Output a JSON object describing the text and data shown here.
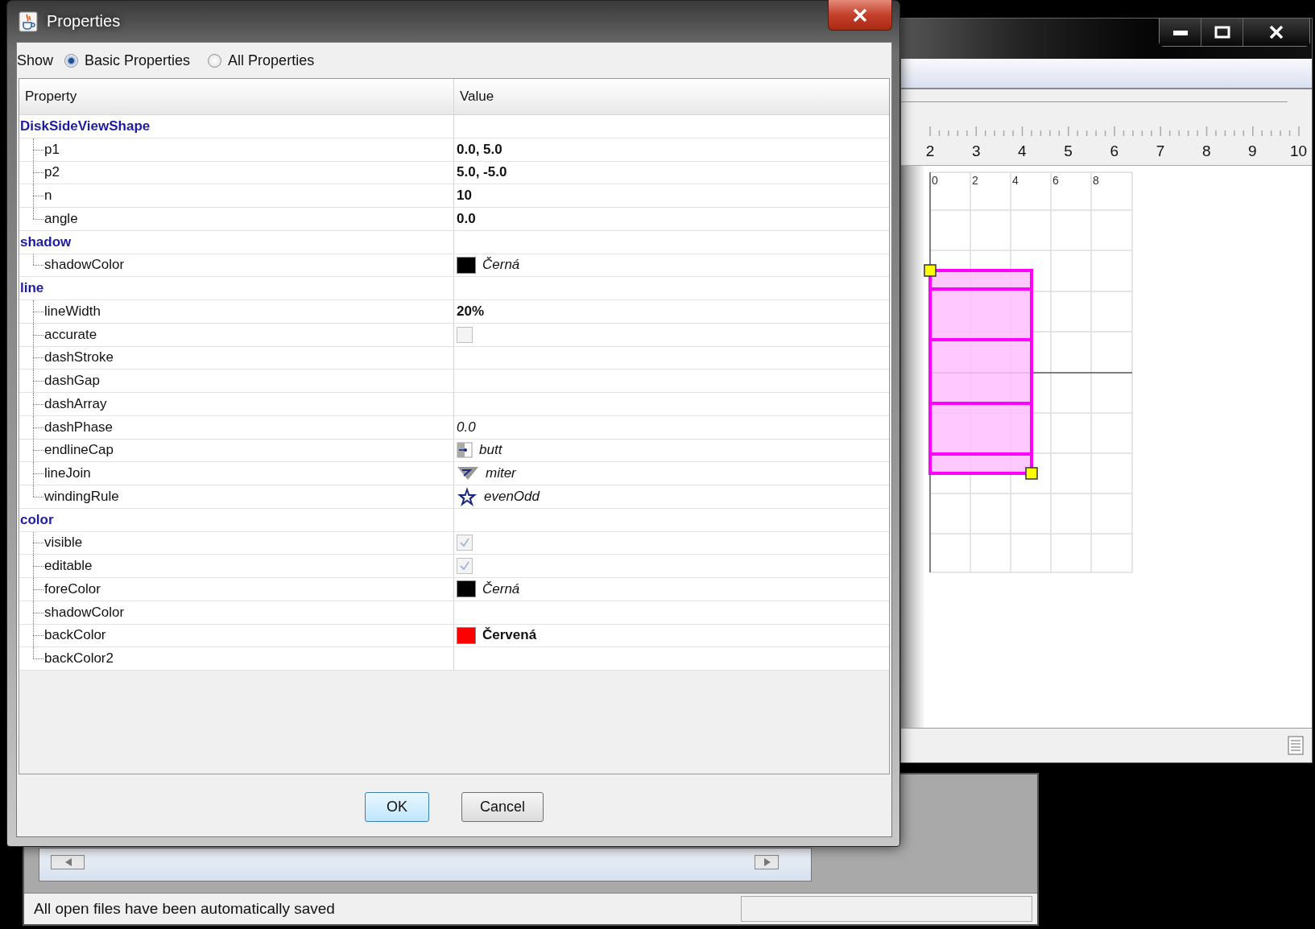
{
  "dialog": {
    "title": "Properties",
    "show_label": "Show",
    "show_options": [
      {
        "label": "Basic Properties",
        "selected": true
      },
      {
        "label": "All Properties",
        "selected": false
      }
    ],
    "columns": [
      "Property",
      "Value"
    ],
    "groups": [
      {
        "name": "DiskSideViewShape",
        "children": [
          {
            "name": "p1",
            "value": {
              "kind": "bold",
              "text": "0.0, 5.0"
            }
          },
          {
            "name": "p2",
            "value": {
              "kind": "bold",
              "text": "5.0, -5.0"
            }
          },
          {
            "name": "n",
            "value": {
              "kind": "bold",
              "text": "10"
            }
          },
          {
            "name": "angle",
            "value": {
              "kind": "bold",
              "text": "0.0"
            }
          }
        ]
      },
      {
        "name": "shadow",
        "children": [
          {
            "name": "shadowColor",
            "value": {
              "kind": "swatch",
              "color": "#000000",
              "text": "Černá"
            }
          }
        ]
      },
      {
        "name": "line",
        "children": [
          {
            "name": "lineWidth",
            "value": {
              "kind": "bold",
              "text": "20%"
            }
          },
          {
            "name": "accurate",
            "value": {
              "kind": "checkbox",
              "checked": false
            }
          },
          {
            "name": "dashStroke"
          },
          {
            "name": "dashGap"
          },
          {
            "name": "dashArray"
          },
          {
            "name": "dashPhase",
            "value": {
              "kind": "italic",
              "text": "0.0"
            }
          },
          {
            "name": "endlineCap",
            "value": {
              "kind": "cap",
              "text": "butt"
            }
          },
          {
            "name": "lineJoin",
            "value": {
              "kind": "join",
              "text": "miter"
            }
          },
          {
            "name": "windingRule",
            "value": {
              "kind": "star",
              "text": "evenOdd"
            }
          }
        ]
      },
      {
        "name": "color",
        "children": [
          {
            "name": "visible",
            "value": {
              "kind": "checkbox",
              "checked": true
            }
          },
          {
            "name": "editable",
            "value": {
              "kind": "checkbox",
              "checked": true
            }
          },
          {
            "name": "foreColor",
            "value": {
              "kind": "swatch",
              "color": "#000000",
              "text": "Černá"
            }
          },
          {
            "name": "shadowColor"
          },
          {
            "name": "backColor",
            "value": {
              "kind": "swatch-bold",
              "color": "#ff0000",
              "text": "Červená"
            }
          },
          {
            "name": "backColor2"
          }
        ]
      }
    ],
    "buttons": [
      {
        "label": "OK",
        "default": true
      },
      {
        "label": "Cancel",
        "default": false
      }
    ]
  },
  "editor_window": {
    "ruler_labels": [
      "2",
      "3",
      "4",
      "5",
      "6",
      "7",
      "8",
      "9",
      "10"
    ],
    "grid_labels": [
      "0",
      "2",
      "4",
      "6",
      "8"
    ]
  },
  "main_window": {
    "status": "All open files have been automatically saved"
  }
}
